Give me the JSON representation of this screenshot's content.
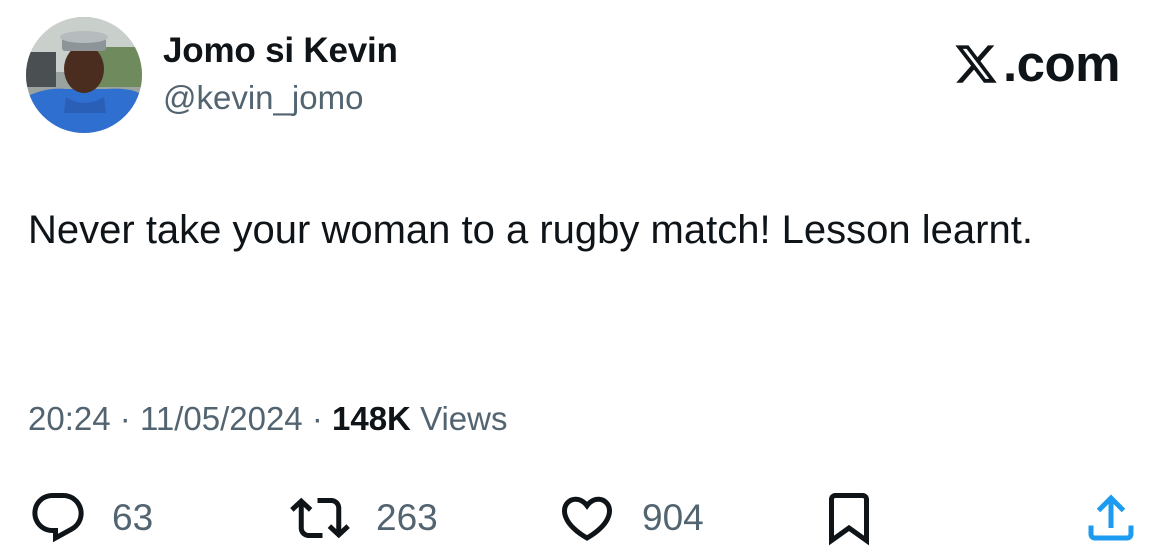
{
  "author": {
    "display_name": "Jomo si Kevin",
    "handle": "@kevin_jomo",
    "avatar_icon": "profile-photo"
  },
  "brand": {
    "logo_icon": "x-logo-icon",
    "text": ".com"
  },
  "tweet": {
    "text": "Never take your woman to a rugby match! Lesson learnt.",
    "time": "20:24",
    "separator": "·",
    "date": "11/05/2024",
    "views_count": "148K",
    "views_label": "Views"
  },
  "actions": {
    "replies": {
      "icon": "reply-icon",
      "count": "63"
    },
    "reposts": {
      "icon": "repost-icon",
      "count": "263"
    },
    "likes": {
      "icon": "heart-icon",
      "count": "904"
    },
    "bookmark": {
      "icon": "bookmark-icon"
    },
    "share": {
      "icon": "share-icon"
    }
  },
  "colors": {
    "primary_text": "#0f1419",
    "secondary_text": "#536471",
    "background": "#ffffff"
  }
}
